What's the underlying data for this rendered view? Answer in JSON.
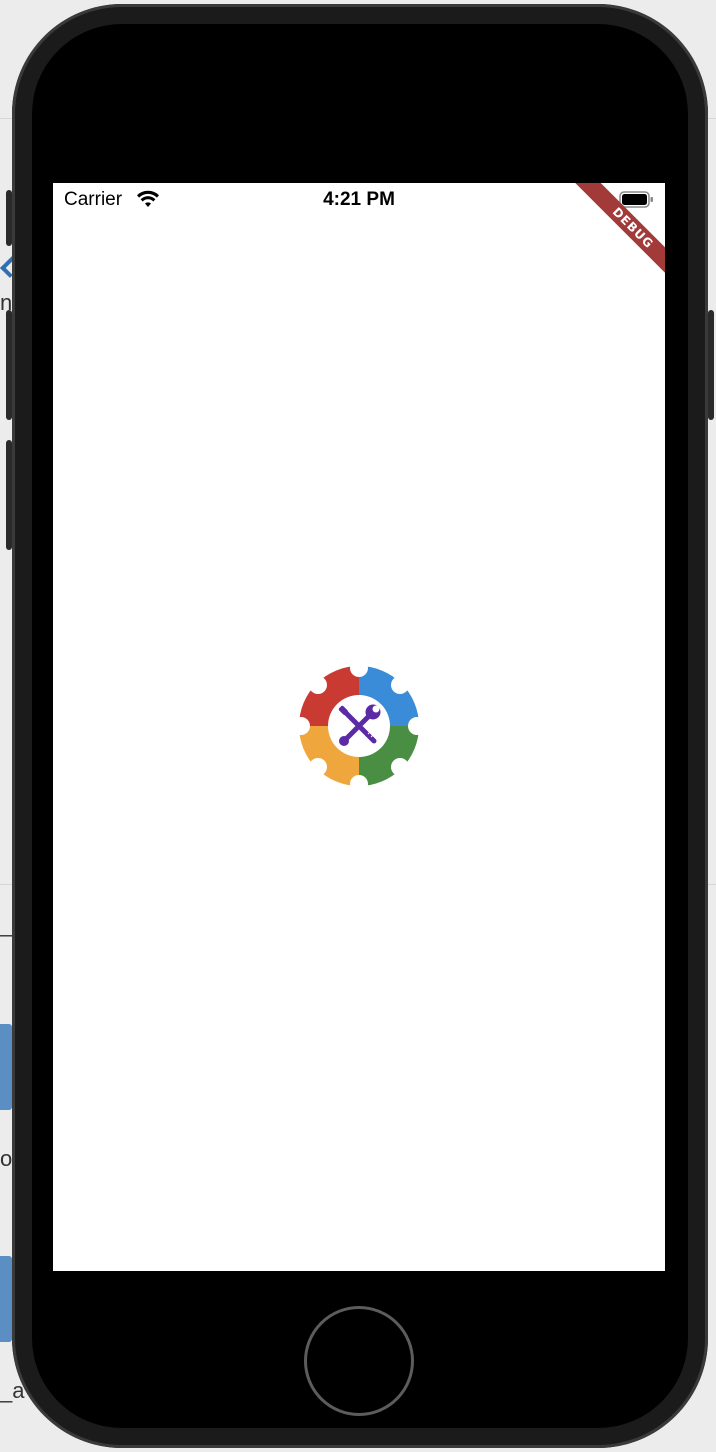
{
  "desktop": {
    "fragments": [
      "n",
      "_a",
      "op",
      "_a"
    ]
  },
  "status_bar": {
    "carrier": "Carrier",
    "time": "4:21 PM",
    "wifi_icon": "wifi-icon",
    "battery_icon": "battery-icon"
  },
  "debug_banner": {
    "label": "DEBUG",
    "color": "#a33a3a"
  },
  "app": {
    "logo_icon": "gear-tools-logo-icon",
    "colors": {
      "red": "#c93a33",
      "blue": "#3a8bd8",
      "orange": "#efa73d",
      "green": "#4a8e44",
      "tools": "#5b2aa6"
    }
  }
}
